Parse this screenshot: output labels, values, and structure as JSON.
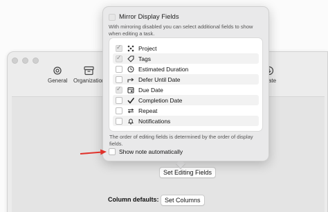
{
  "toolbar": {
    "general_label": "General",
    "organization_label": "Organization",
    "update_label": "pdate"
  },
  "popover": {
    "mirror_label": "Mirror Display Fields",
    "mirror_description": "With mirroring disabled you can select additional fields to show when editing a task.",
    "fields": [
      {
        "label": "Project",
        "icon": "project-icon",
        "checked": true
      },
      {
        "label": "Tags",
        "icon": "tag-icon",
        "checked": true
      },
      {
        "label": "Estimated Duration",
        "icon": "clock-icon",
        "checked": false
      },
      {
        "label": "Defer Until Date",
        "icon": "defer-arrow-icon",
        "checked": false
      },
      {
        "label": "Due Date",
        "icon": "calendar-icon",
        "checked": true
      },
      {
        "label": "Completion Date",
        "icon": "checkmark-icon",
        "checked": false
      },
      {
        "label": "Repeat",
        "icon": "repeat-icon",
        "checked": false
      },
      {
        "label": "Notifications",
        "icon": "bell-icon",
        "checked": false
      }
    ],
    "order_note": "The order of editing fields is determined by the order of display fields.",
    "show_note_label": "Show note automatically"
  },
  "main": {
    "set_editing_fields_label": "Set Editing Fields",
    "column_defaults_label": "Column defaults:",
    "set_columns_label": "Set Columns"
  },
  "colors": {
    "arrow_red": "#e0322b",
    "window_bg": "#ececec",
    "popover_bg": "#e9e9ea"
  }
}
